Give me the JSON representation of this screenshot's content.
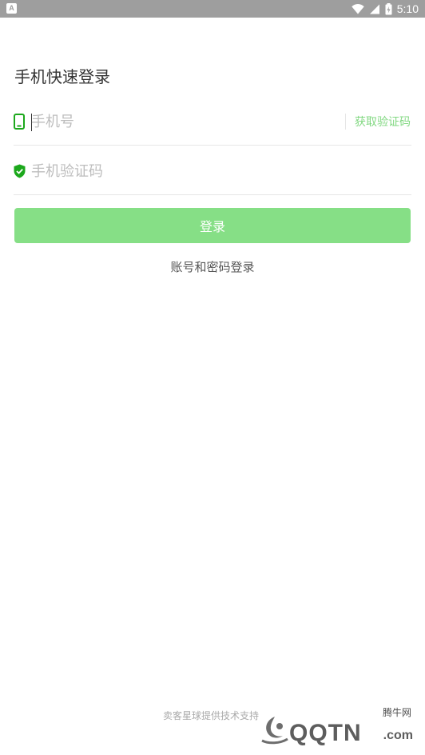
{
  "status_bar": {
    "app_icon_letter": "A",
    "time": "5:10"
  },
  "page": {
    "title": "手机快速登录"
  },
  "form": {
    "phone_placeholder": "手机号",
    "get_code_label": "获取验证码",
    "code_placeholder": "手机验证码",
    "login_label": "登录",
    "alt_login_label": "账号和密码登录"
  },
  "footer": {
    "support_text": "卖客星球提供技术支持"
  },
  "watermark": {
    "brand": "QQTN",
    "cn": "腾牛网",
    "dotcom": ".com"
  },
  "colors": {
    "status_bar": "#9e9e9e",
    "accent_green": "#1ca81c",
    "button_green": "#86df86",
    "link_green": "#82d882"
  },
  "icons": {
    "phone": "phone-icon",
    "shield": "shield-check-icon",
    "wifi": "wifi-icon",
    "signal": "signal-icon",
    "battery": "battery-icon"
  }
}
